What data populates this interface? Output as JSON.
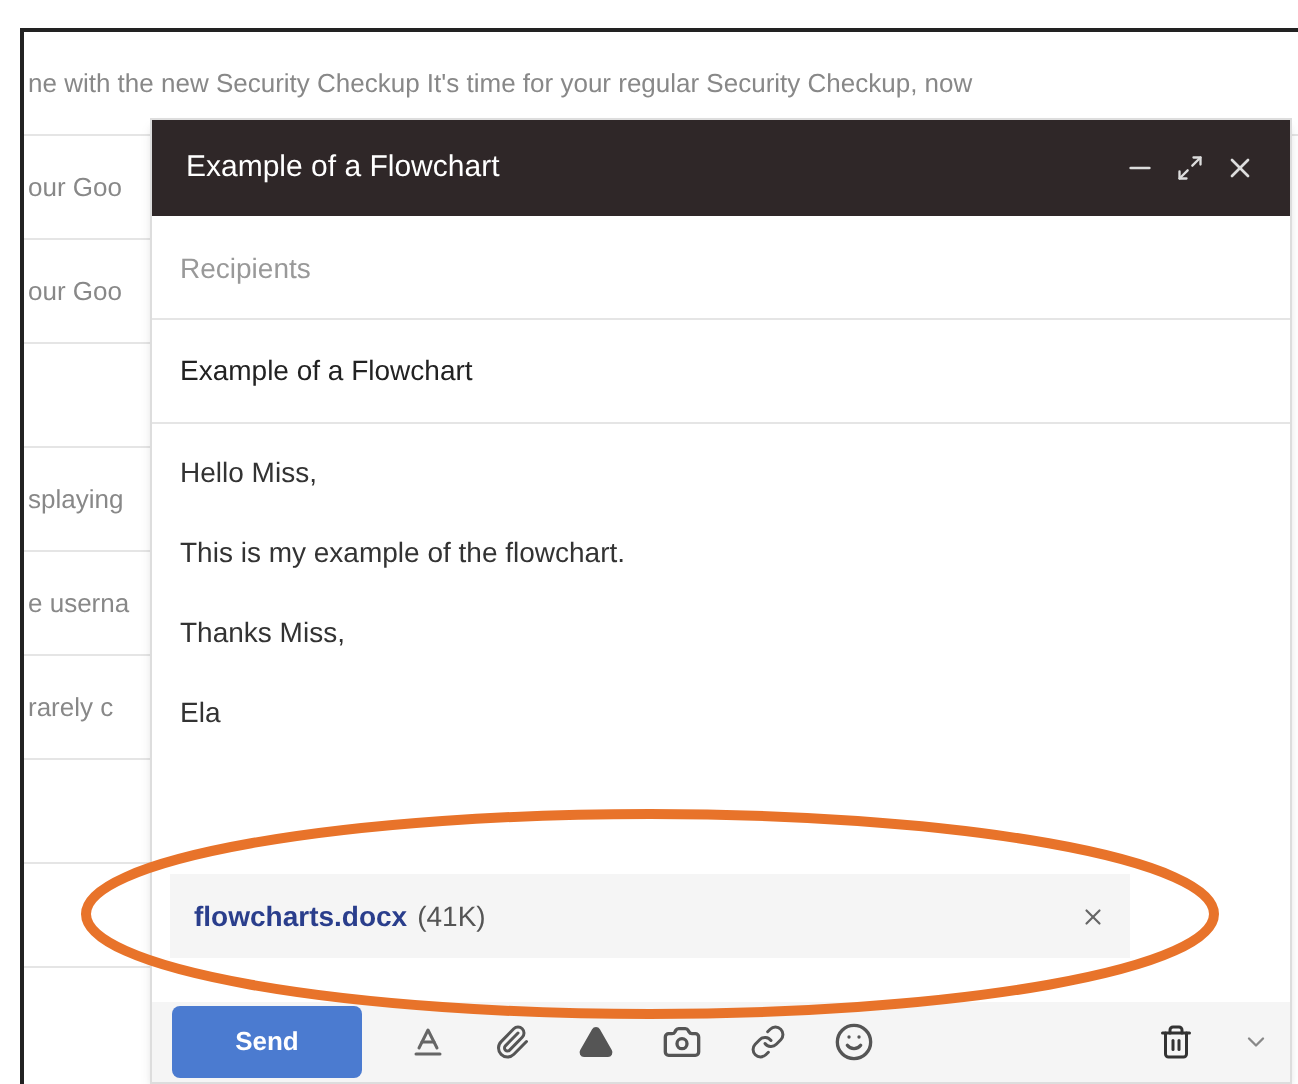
{
  "inbox_rows": [
    "ne with the new Security Checkup It's time for your regular Security Checkup, now",
    "our Goo",
    "our Goo",
    "splaying",
    "e userna",
    "rarely c"
  ],
  "compose": {
    "title": "Example of a Flowchart",
    "recipients": {
      "placeholder": "Recipients"
    },
    "subject": "Example of a Flowchart",
    "body": [
      "Hello Miss,",
      "This is my example of the flowchart.",
      "Thanks Miss,",
      "Ela"
    ],
    "attachment": {
      "name": "flowcharts.docx",
      "size": "(41K)"
    },
    "send_button": "Send"
  }
}
